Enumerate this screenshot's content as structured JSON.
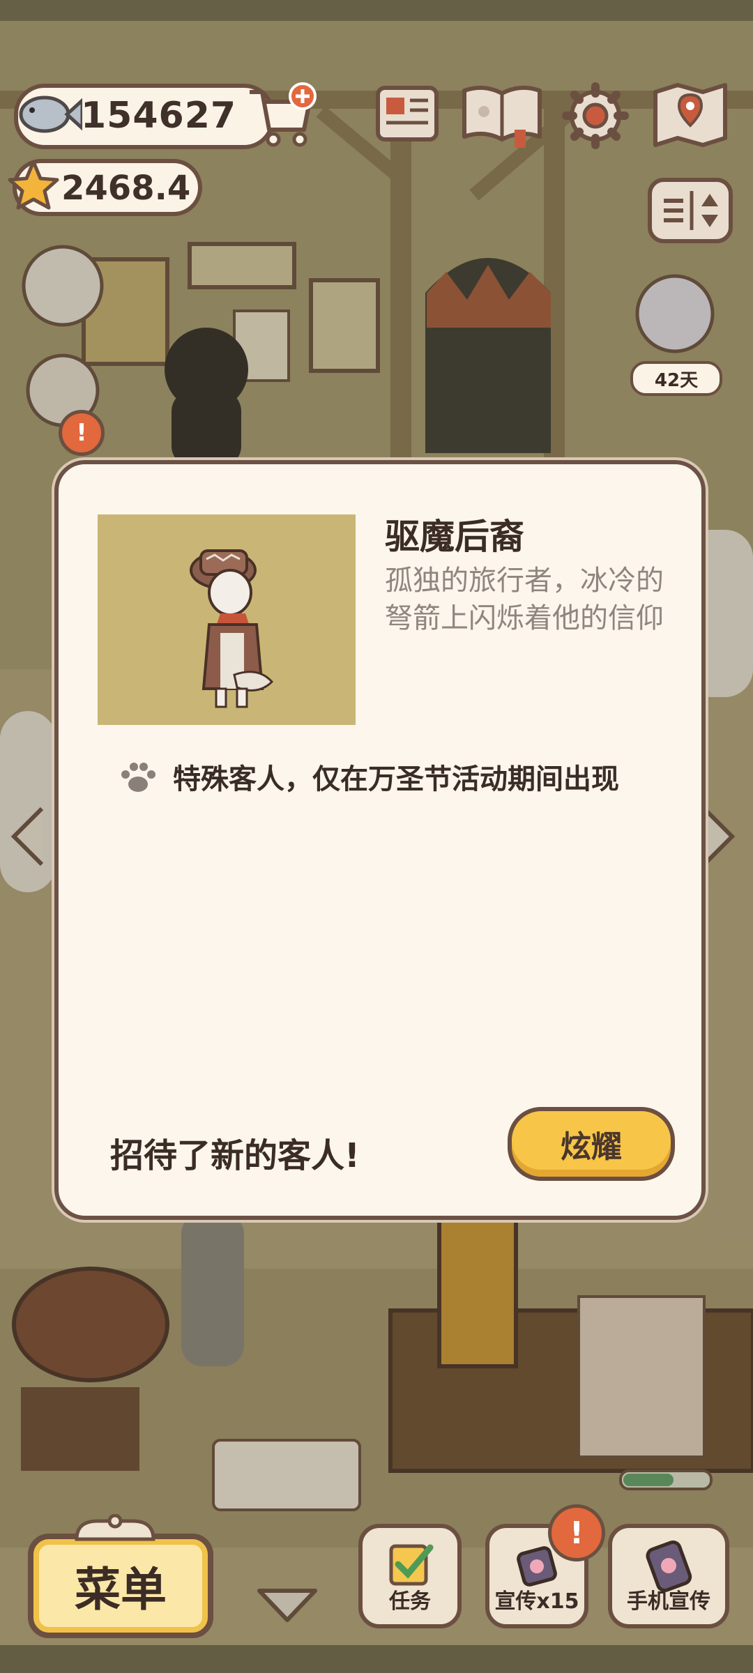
{
  "hud": {
    "fish_count": "154627",
    "star_count": "2468.4",
    "icons": [
      "fish-icon",
      "shop-cart-icon",
      "star-icon",
      "newspaper-icon",
      "catalog-book-icon",
      "settings-gear-icon",
      "map-icon",
      "sort-toggle-icon"
    ]
  },
  "scene": {
    "days_tag": "42天"
  },
  "modal": {
    "title": "驱魔后裔",
    "description": "孤独的旅行者，冰冷的弩箭上闪烁着他的信仰",
    "special_note": "特殊客人，仅在万圣节活动期间出现",
    "welcome_text": "招待了新的客人!",
    "show_button": "炫耀",
    "portrait_bg": "#c9b676"
  },
  "bottom_bar": {
    "menu_label": "菜单",
    "tasks_label": "任务",
    "promo_label": "宣传x15",
    "phone_promo_label": "手机宣传",
    "badge_symbol": "!"
  },
  "colors": {
    "accent_yellow": "#f7c548",
    "outline_brown": "#6b4f40",
    "panel_cream": "#fcf6ed",
    "badge_orange": "#e2683d"
  }
}
